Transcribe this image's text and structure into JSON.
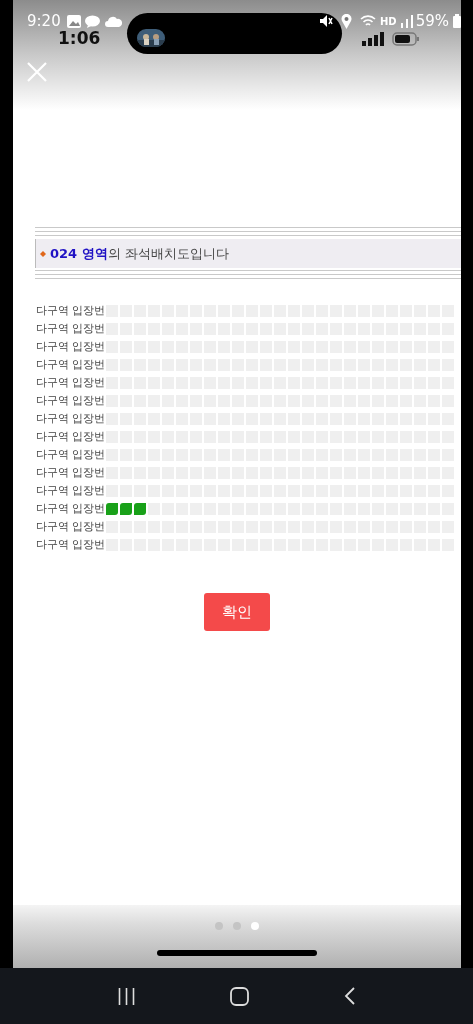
{
  "status_bar": {
    "time": "9:20",
    "hd_label": "HD",
    "battery": "59%"
  },
  "inner_status_bar": {
    "time": "1:06"
  },
  "banner": {
    "title": "**024 영역**의 좌석배치도입니다"
  },
  "rows": [
    {
      "label": "다구역 입장번",
      "seats_available": [
        false,
        false,
        false,
        false,
        false,
        false,
        false,
        false,
        false,
        false,
        false,
        false,
        false,
        false,
        false,
        false,
        false,
        false,
        false,
        false,
        false,
        false,
        false,
        false,
        false
      ]
    },
    {
      "label": "다구역 입장번",
      "seats_available": [
        false,
        false,
        false,
        false,
        false,
        false,
        false,
        false,
        false,
        false,
        false,
        false,
        false,
        false,
        false,
        false,
        false,
        false,
        false,
        false,
        false,
        false,
        false,
        false,
        false
      ]
    },
    {
      "label": "다구역 입장번",
      "seats_available": [
        false,
        false,
        false,
        false,
        false,
        false,
        false,
        false,
        false,
        false,
        false,
        false,
        false,
        false,
        false,
        false,
        false,
        false,
        false,
        false,
        false,
        false,
        false,
        false,
        false
      ]
    },
    {
      "label": "다구역 입장번",
      "seats_available": [
        false,
        false,
        false,
        false,
        false,
        false,
        false,
        false,
        false,
        false,
        false,
        false,
        false,
        false,
        false,
        false,
        false,
        false,
        false,
        false,
        false,
        false,
        false,
        false,
        false
      ]
    },
    {
      "label": "다구역 입장번",
      "seats_available": [
        false,
        false,
        false,
        false,
        false,
        false,
        false,
        false,
        false,
        false,
        false,
        false,
        false,
        false,
        false,
        false,
        false,
        false,
        false,
        false,
        false,
        false,
        false,
        false,
        false
      ]
    },
    {
      "label": "다구역 입장번",
      "seats_available": [
        false,
        false,
        false,
        false,
        false,
        false,
        false,
        false,
        false,
        false,
        false,
        false,
        false,
        false,
        false,
        false,
        false,
        false,
        false,
        false,
        false,
        false,
        false,
        false,
        false
      ]
    },
    {
      "label": "다구역 입장번",
      "seats_available": [
        false,
        false,
        false,
        false,
        false,
        false,
        false,
        false,
        false,
        false,
        false,
        false,
        false,
        false,
        false,
        false,
        false,
        false,
        false,
        false,
        false,
        false,
        false,
        false,
        false
      ]
    },
    {
      "label": "다구역 입장번",
      "seats_available": [
        false,
        false,
        false,
        false,
        false,
        false,
        false,
        false,
        false,
        false,
        false,
        false,
        false,
        false,
        false,
        false,
        false,
        false,
        false,
        false,
        false,
        false,
        false,
        false,
        false
      ]
    },
    {
      "label": "다구역 입장번",
      "seats_available": [
        false,
        false,
        false,
        false,
        false,
        false,
        false,
        false,
        false,
        false,
        false,
        false,
        false,
        false,
        false,
        false,
        false,
        false,
        false,
        false,
        false,
        false,
        false,
        false,
        false
      ]
    },
    {
      "label": "다구역 입장번",
      "seats_available": [
        false,
        false,
        false,
        false,
        false,
        false,
        false,
        false,
        false,
        false,
        false,
        false,
        false,
        false,
        false,
        false,
        false,
        false,
        false,
        false,
        false,
        false,
        false,
        false,
        false
      ]
    },
    {
      "label": "다구역 입장번",
      "seats_available": [
        false,
        false,
        false,
        false,
        false,
        false,
        false,
        false,
        false,
        false,
        false,
        false,
        false,
        false,
        false,
        false,
        false,
        false,
        false,
        false,
        false,
        false,
        false,
        false,
        false
      ]
    },
    {
      "label": "다구역 입장번",
      "seats_available": [
        true,
        true,
        true,
        false,
        false,
        false,
        false,
        false,
        false,
        false,
        false,
        false,
        false,
        false,
        false,
        false,
        false,
        false,
        false,
        false,
        false,
        false,
        false,
        false,
        false
      ]
    },
    {
      "label": "다구역 입장번",
      "seats_available": [
        false,
        false,
        false,
        false,
        false,
        false,
        false,
        false,
        false,
        false,
        false,
        false,
        false,
        false,
        false,
        false,
        false,
        false,
        false,
        false,
        false,
        false,
        false,
        false,
        false
      ]
    },
    {
      "label": "다구역 입장번",
      "seats_available": [
        false,
        false,
        false,
        false,
        false,
        false,
        false,
        false,
        false,
        false,
        false,
        false,
        false,
        false,
        false,
        false,
        false,
        false,
        false,
        false,
        false,
        false,
        false,
        false,
        false
      ]
    }
  ],
  "confirm_button": "확인",
  "page_dots": [
    {
      "selected": false
    },
    {
      "selected": false
    },
    {
      "selected": true
    }
  ]
}
